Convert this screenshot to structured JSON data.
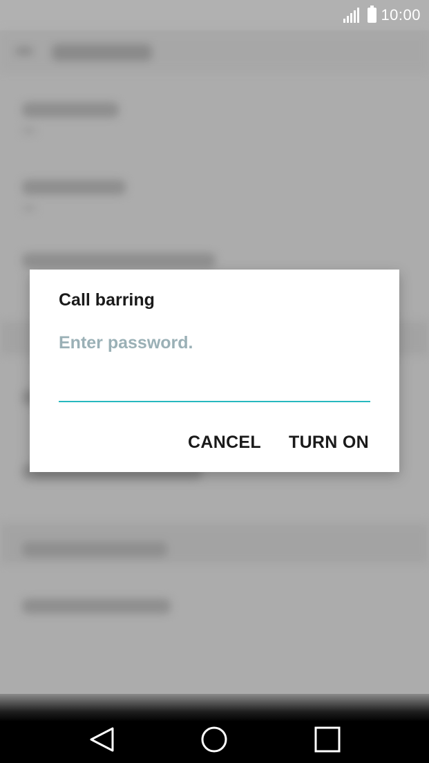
{
  "status_bar": {
    "time": "10:00",
    "signal_icon": "signal-icon",
    "battery_icon": "battery-icon"
  },
  "dialog": {
    "title": "Call barring",
    "password_placeholder": "Enter password.",
    "password_value": "",
    "cancel_label": "CANCEL",
    "turn_on_label": "TURN ON",
    "accent_color": "#27b8bf"
  },
  "nav_bar": {
    "back_icon": "back-icon",
    "home_icon": "home-icon",
    "recents_icon": "recents-icon"
  }
}
